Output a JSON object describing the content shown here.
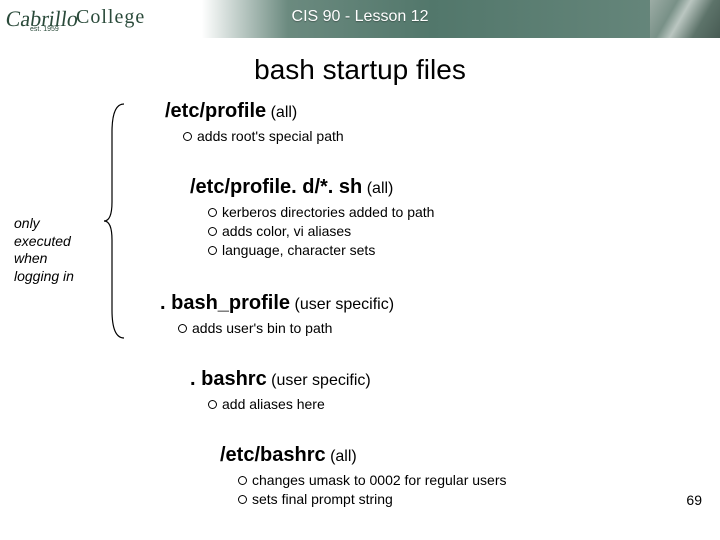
{
  "header": {
    "logo_main": "Cabrillo",
    "logo_word": "College",
    "logo_sub": "est. 1959",
    "course": "CIS 90 - Lesson 12"
  },
  "slide": {
    "title": "bash startup files",
    "side_note": "only executed when logging in",
    "page_number": "69"
  },
  "files": [
    {
      "name": "/etc/profile",
      "scope": "(all)",
      "bullets": [
        "adds root's special path"
      ]
    },
    {
      "name": "/etc/profile. d/*. sh",
      "scope": "(all)",
      "bullets": [
        "kerberos directories added to path",
        "adds color, vi aliases",
        "language, character sets"
      ]
    },
    {
      "name": ". bash_profile",
      "scope": "(user specific)",
      "bullets": [
        "adds user's bin to path"
      ]
    },
    {
      "name": ". bashrc",
      "scope": "(user specific)",
      "bullets": [
        "add aliases here"
      ]
    },
    {
      "name": "/etc/bashrc",
      "scope": "(all)",
      "bullets": [
        "changes umask to 0002 for regular users",
        "sets final prompt string"
      ]
    }
  ]
}
